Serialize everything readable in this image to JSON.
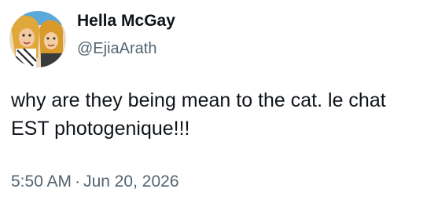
{
  "author": {
    "display_name": "Hella McGay",
    "handle": "@EjiaArath",
    "avatar_icon": "cartoon-characters-avatar"
  },
  "tweet": {
    "text": "why are they being mean to the cat. le chat EST photogenique!!!",
    "time": "5:50 AM",
    "separator": "·",
    "date": "Jun 20, 2026"
  },
  "colors": {
    "text_primary": "#0f1419",
    "text_secondary": "#536471",
    "background": "#ffffff"
  }
}
